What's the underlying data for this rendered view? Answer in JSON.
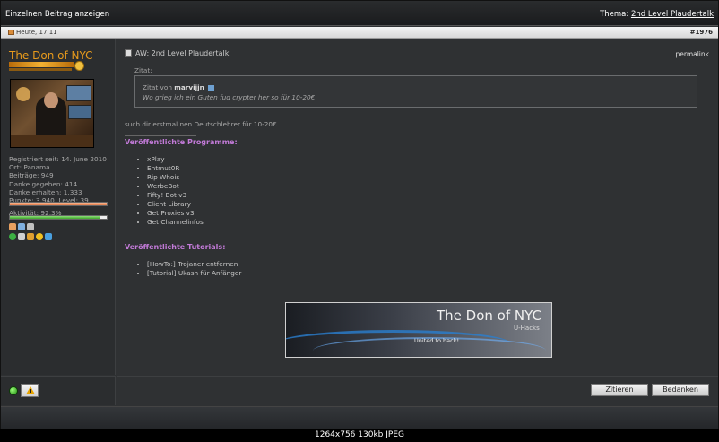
{
  "header": {
    "title": "Einzelnen Beitrag anzeigen",
    "thread_prefix": "Thema:",
    "thread_link": "2nd Level Plaudertalk"
  },
  "postbar": {
    "date": "Heute, 17:11",
    "post_number": "#1976"
  },
  "user": {
    "name": "The Don of NYC",
    "stats": [
      "Registriert seit: 14. June 2010",
      "Ort: Panama",
      "Beiträge: 949",
      "Danke gegeben: 414",
      "Danke erhalten: 1.333",
      "Punkte: 3.940, Level: 39"
    ],
    "level_progress_pct": 100,
    "activity_label": "Aktivität: 92,3%",
    "activity_pct": 92.3
  },
  "post": {
    "title": "AW: 2nd Level Plaudertalk",
    "permalink": "permalink",
    "quote_label": "Zitat:",
    "quote_by_prefix": "Zitat von",
    "quote_author": "marvijjn",
    "quote_text": "Wo grieg ich ein Guten fud crypter her so für 10-20€",
    "message": "such dir erstmal nen Deutschlehrer für 10-20€..."
  },
  "signature": {
    "programs_heading": "Veröffentlichte Programme:",
    "programs": [
      "xPlay",
      "Entmut0R",
      "Rip Whois",
      "WerbeBot",
      "Fifty! Bot v3",
      "Client Library",
      "Get Proxies v3",
      "Get Channelinfos"
    ],
    "tutorials_heading": "Veröffentlichte Tutorials:",
    "tutorials": [
      "[HowTo:] Trojaner entfernen",
      "[Tutorial] Ukash für Anfänger"
    ],
    "banner_title": "The Don of NYC",
    "banner_sub": "U-Hacks",
    "banner_slogan": "United to hack!"
  },
  "actions": {
    "quote_button": "Zitieren",
    "thanks_button": "Bedanken"
  },
  "caption": "1264x756 130kb JPEG"
}
